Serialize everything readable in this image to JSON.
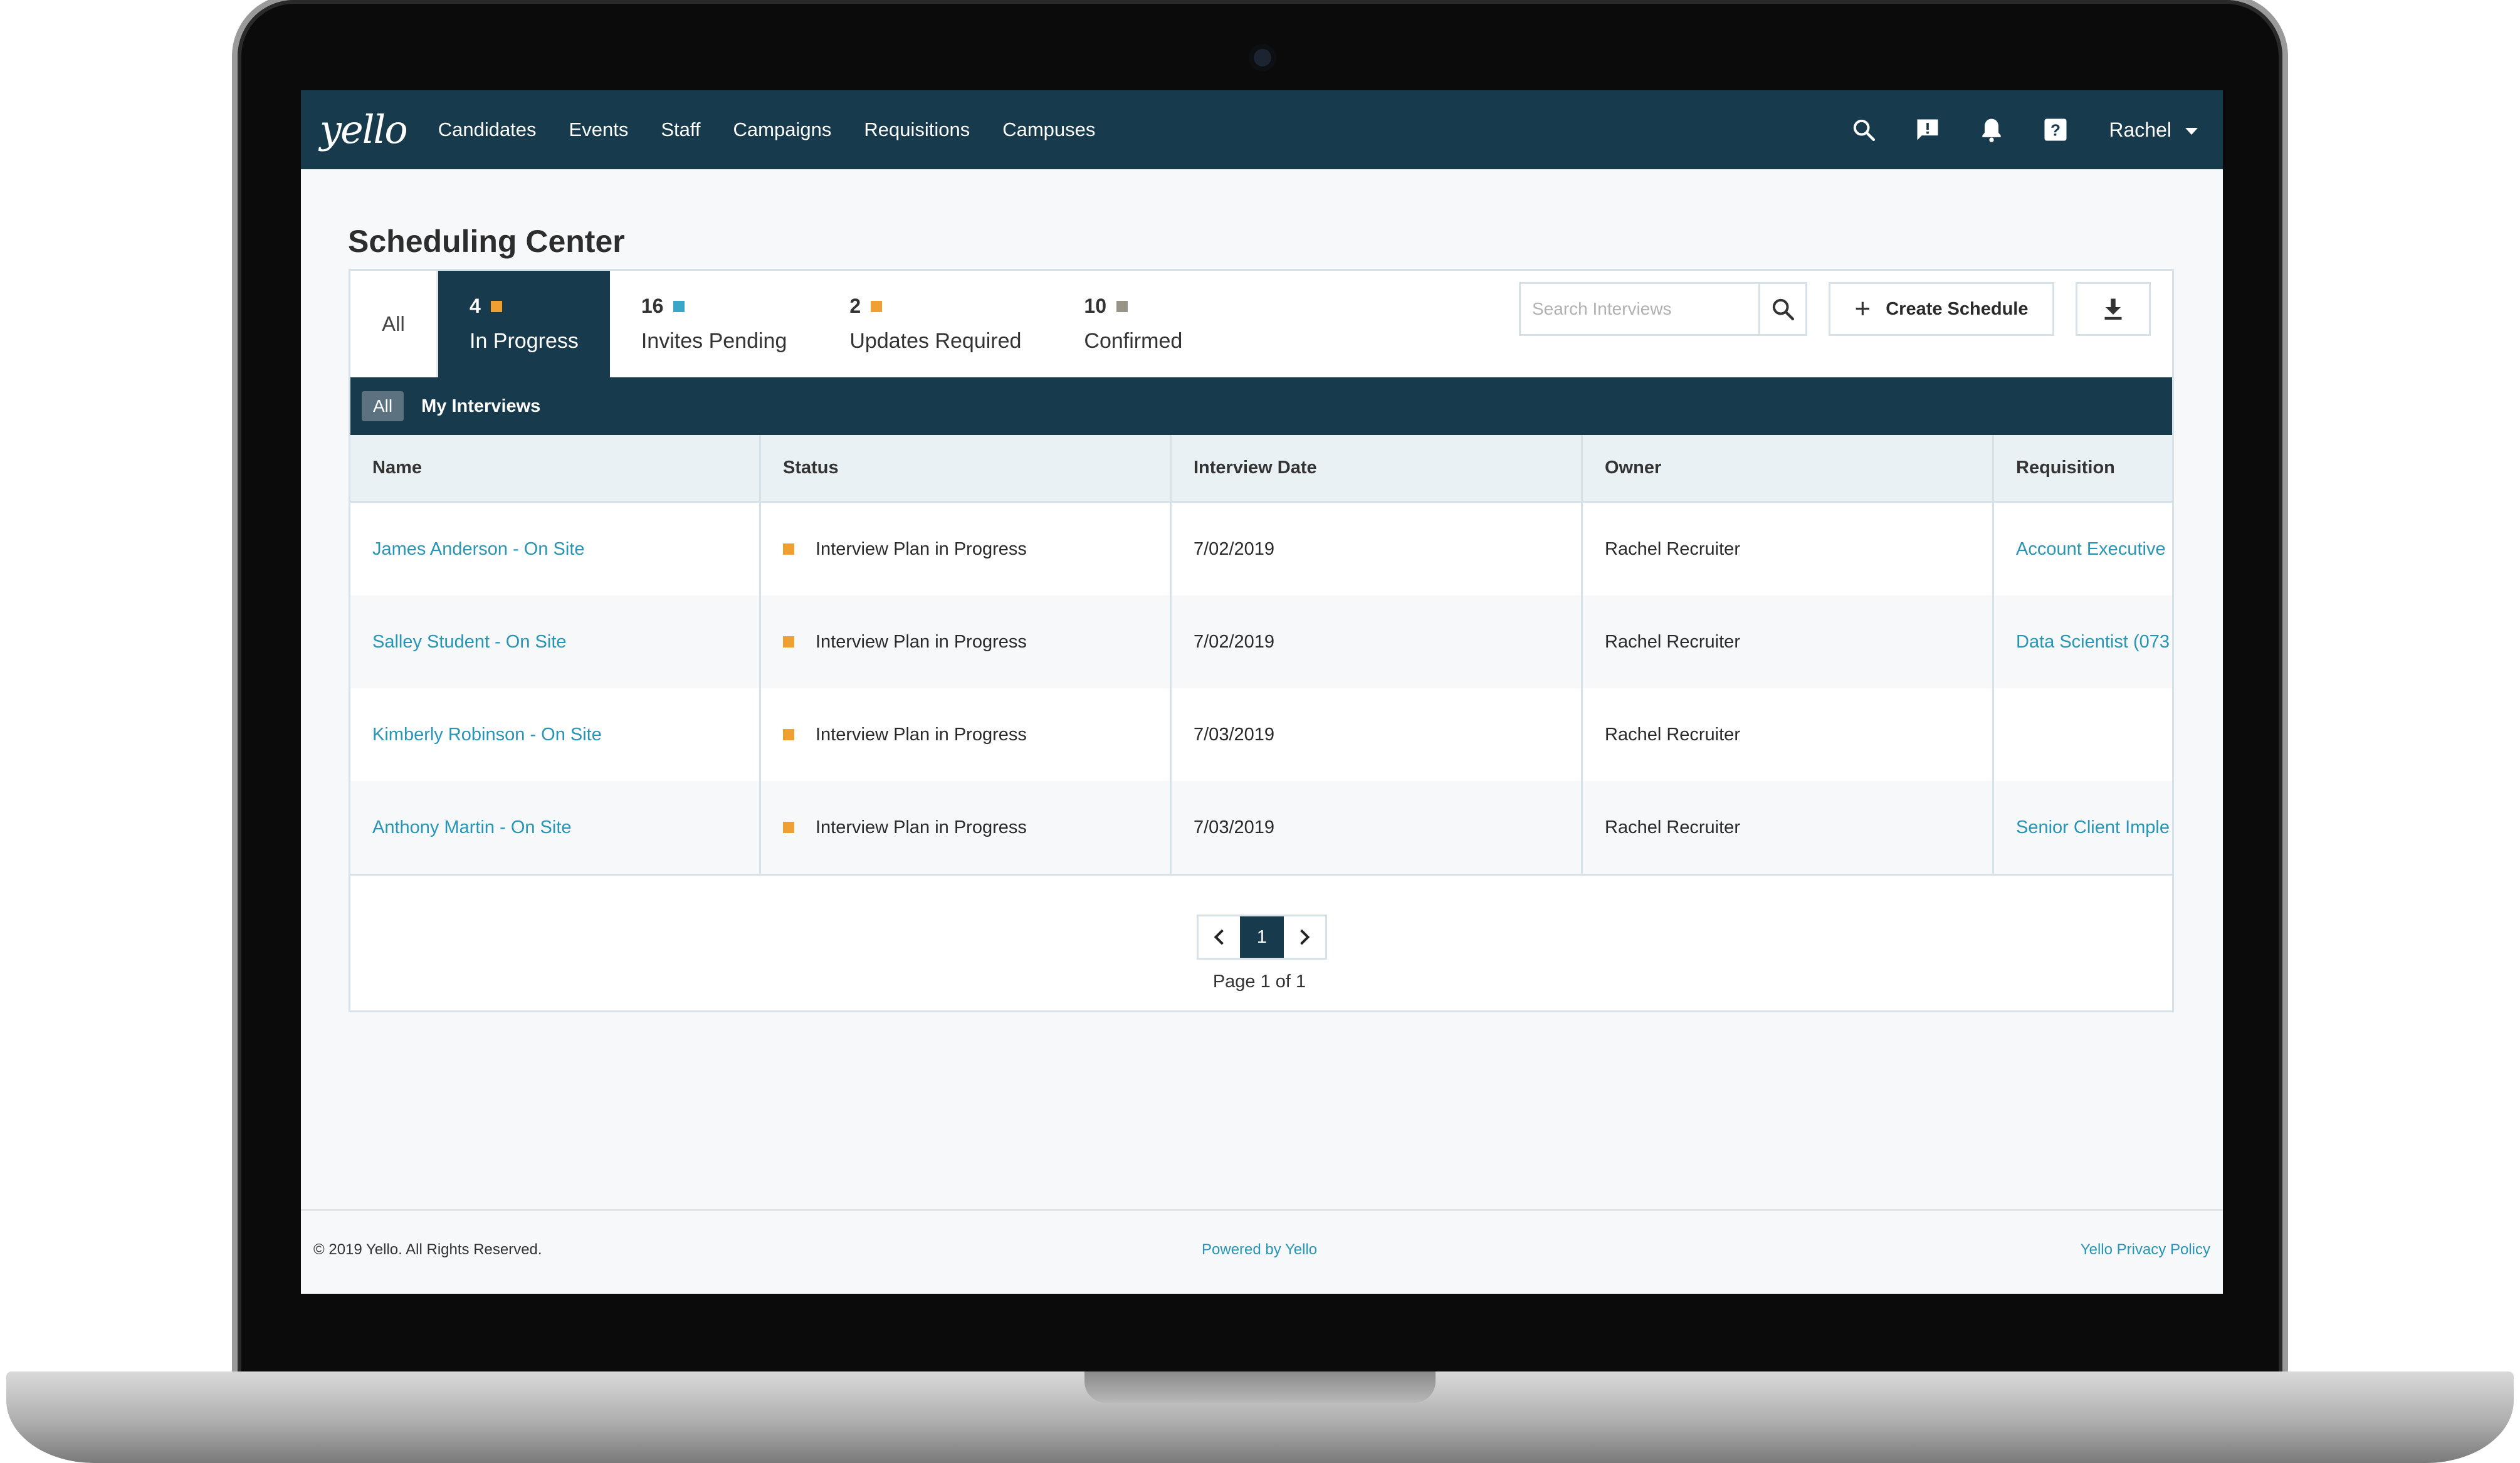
{
  "nav": {
    "logo": "yello",
    "links": [
      "Candidates",
      "Events",
      "Staff",
      "Campaigns",
      "Requisitions",
      "Campuses"
    ],
    "user": "Rachel",
    "icons": [
      "search-icon",
      "message-alert-icon",
      "bell-icon",
      "help-icon"
    ]
  },
  "page": {
    "title": "Scheduling Center"
  },
  "tabs": {
    "all": "All",
    "items": [
      {
        "count": "4",
        "label": "In Progress",
        "color": "#f0a030",
        "active": true
      },
      {
        "count": "16",
        "label": "Invites Pending",
        "color": "#3aa6c9",
        "active": false
      },
      {
        "count": "2",
        "label": "Updates Required",
        "color": "#f0a030",
        "active": false
      },
      {
        "count": "10",
        "label": "Confirmed",
        "color": "#9a9388",
        "active": false
      }
    ]
  },
  "search": {
    "placeholder": "Search Interviews"
  },
  "actions": {
    "create": "Create Schedule"
  },
  "filters": {
    "all": "All",
    "mine": "My Interviews"
  },
  "table": {
    "columns": [
      "Name",
      "Status",
      "Interview Date",
      "Owner",
      "Requisition"
    ],
    "rows": [
      {
        "name": "James Anderson - On Site",
        "status": "Interview Plan in Progress",
        "date": "7/02/2019",
        "owner": "Rachel Recruiter",
        "requisition": "Account Executive"
      },
      {
        "name": "Salley Student - On Site",
        "status": "Interview Plan in Progress",
        "date": "7/02/2019",
        "owner": "Rachel Recruiter",
        "requisition": "Data Scientist (073"
      },
      {
        "name": "Kimberly Robinson - On Site",
        "status": "Interview Plan in Progress",
        "date": "7/03/2019",
        "owner": "Rachel Recruiter",
        "requisition": ""
      },
      {
        "name": "Anthony Martin - On Site",
        "status": "Interview Plan in Progress",
        "date": "7/03/2019",
        "owner": "Rachel Recruiter",
        "requisition": "Senior Client Imple"
      }
    ]
  },
  "pagination": {
    "current": "1",
    "info": "Page 1 of 1"
  },
  "footer": {
    "copyright": "© 2019 Yello. All Rights Reserved.",
    "powered": "Powered by Yello",
    "privacy": "Yello Privacy Policy"
  },
  "colors": {
    "navy": "#173a4c",
    "link": "#2795b5",
    "status_orange": "#f0a030"
  }
}
